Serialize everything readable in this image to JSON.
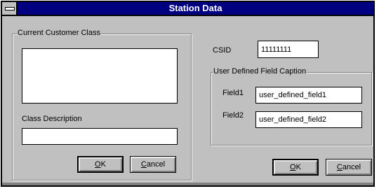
{
  "window": {
    "title": "Station Data"
  },
  "left": {
    "group_title": "Current Customer Class",
    "class_description_label": "Class Description",
    "class_description_value": "",
    "ok_button": {
      "mnemonic": "O",
      "rest": "K"
    },
    "cancel_button": {
      "mnemonic": "C",
      "rest": "ancel"
    }
  },
  "right": {
    "csid_label": "CSID",
    "csid_value": "11111111",
    "udf_group_title": "User Defined Field Caption",
    "field1_label": "Field1",
    "field1_value": "user_defined_field1",
    "field2_label": "Field2",
    "field2_value": "user_defined_field2",
    "ok_button": {
      "mnemonic": "O",
      "rest": "K"
    },
    "cancel_button": {
      "mnemonic": "C",
      "rest": "ancel"
    }
  },
  "colors": {
    "titlebar": "#000080",
    "dialog_face": "#c0c0c0"
  }
}
